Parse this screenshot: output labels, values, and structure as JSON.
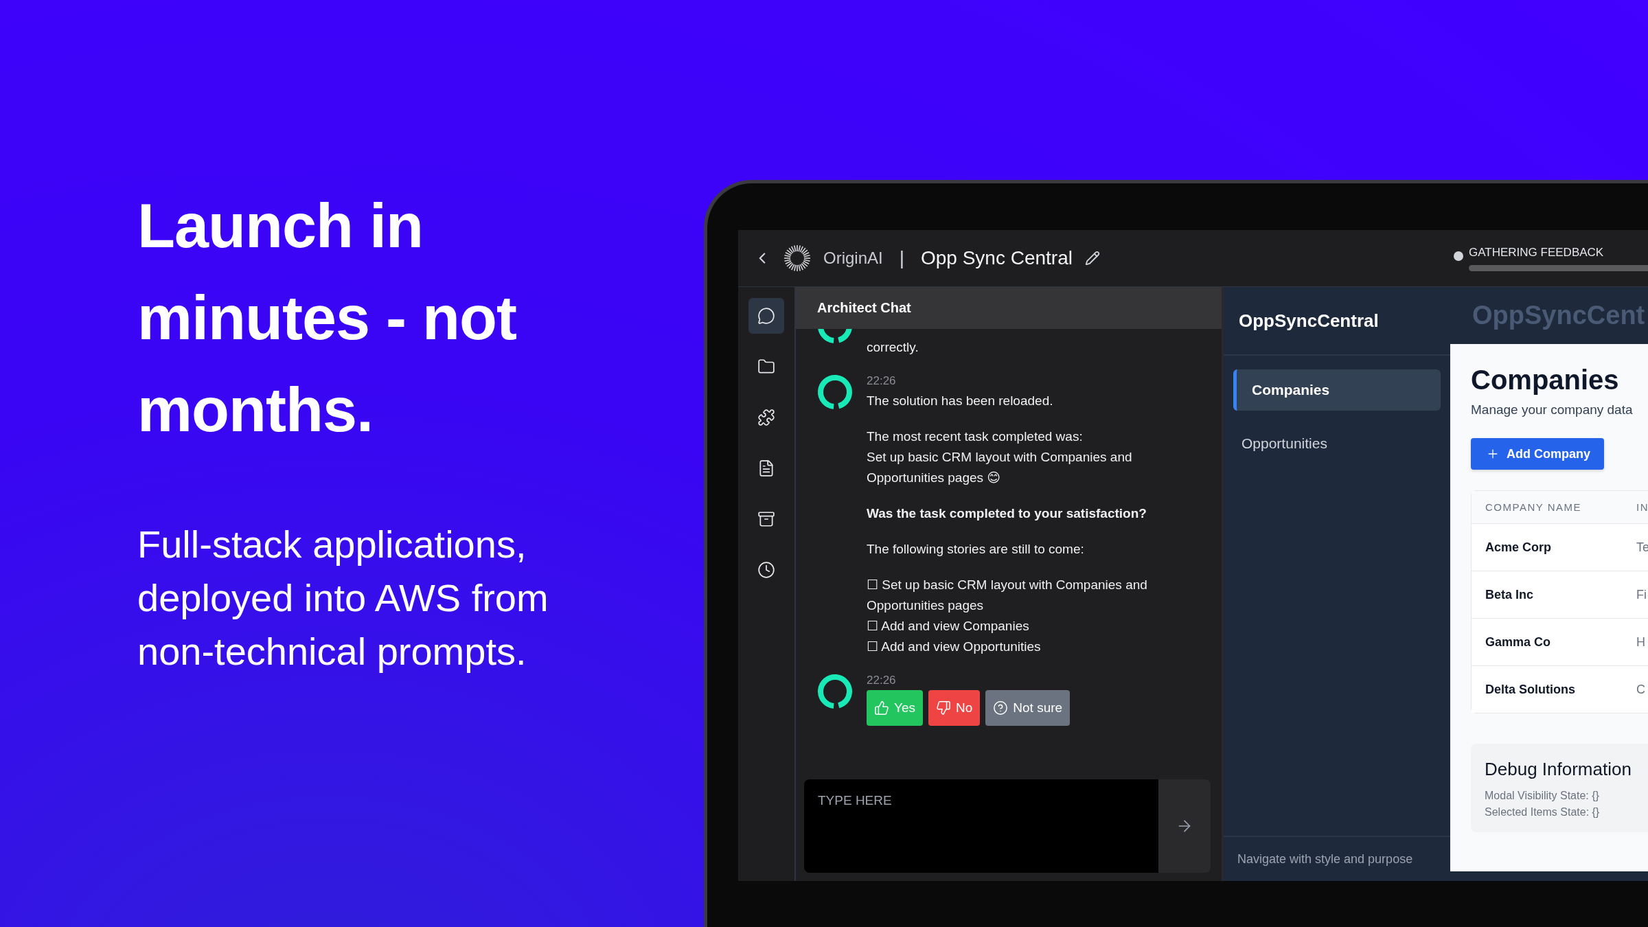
{
  "hero": {
    "headline_lines": [
      "Launch in",
      "minutes - not",
      "months."
    ],
    "subtitle_lines": [
      "Full-stack applications,",
      "deployed into AWS from",
      "non-technical prompts."
    ]
  },
  "top_bar": {
    "brand": "OriginAI",
    "separator": "|",
    "project": "Opp Sync Central",
    "status": "GATHERING FEEDBACK"
  },
  "rail": [
    {
      "selected": true
    },
    {
      "selected": false
    },
    {
      "selected": false
    },
    {
      "selected": false
    },
    {
      "selected": false
    },
    {
      "selected": false
    }
  ],
  "chat": {
    "title": "Architect Chat",
    "messages": [
      {
        "partial": true,
        "blocks": [
          {
            "kind": "text",
            "lines": [
              "correctly."
            ]
          }
        ]
      },
      {
        "partial": false,
        "time": "22:26",
        "blocks": [
          {
            "kind": "text",
            "lines": [
              "The solution has been reloaded."
            ]
          },
          {
            "kind": "text",
            "lines": [
              "The most recent task completed was:",
              "Set up basic CRM layout with Companies and Opportunities pages 😊"
            ]
          },
          {
            "kind": "bold",
            "lines": [
              "Was the task completed to your satisfaction?"
            ]
          },
          {
            "kind": "text",
            "lines": [
              "The following stories are still to come:"
            ]
          },
          {
            "kind": "text",
            "lines": [
              "☐ Set up basic CRM layout with Companies and Opportunities pages",
              "☐ Add and view Companies",
              "☐ Add and view Opportunities"
            ]
          }
        ]
      },
      {
        "partial": false,
        "time": "22:26",
        "buttons": [
          {
            "kind": "yes",
            "label": "Yes"
          },
          {
            "kind": "no",
            "label": "No"
          },
          {
            "kind": "unsure",
            "label": "Not sure"
          }
        ]
      }
    ],
    "input": {
      "placeholder": "TYPE HERE"
    }
  },
  "preview": {
    "sidebar": {
      "title": "OppSyncCentral",
      "items": [
        {
          "label": "Companies",
          "selected": true
        },
        {
          "label": "Opportunities",
          "selected": false
        }
      ],
      "footer": "Navigate with style and purpose"
    },
    "faded_title": "OppSyncCent",
    "page": {
      "title": "Companies",
      "subtitle": "Manage your company data",
      "button": "Add Company",
      "table": {
        "columns": [
          "COMPANY NAME",
          "IN"
        ],
        "rows": [
          [
            "Acme Corp",
            "Te"
          ],
          [
            "Beta Inc",
            "Fi"
          ],
          [
            "Gamma Co",
            "H"
          ],
          [
            "Delta Solutions",
            "C"
          ]
        ]
      },
      "debug": {
        "title": "Debug Information",
        "lines": [
          "Modal Visibility State: {}",
          "Selected Items State: {}"
        ]
      }
    }
  }
}
